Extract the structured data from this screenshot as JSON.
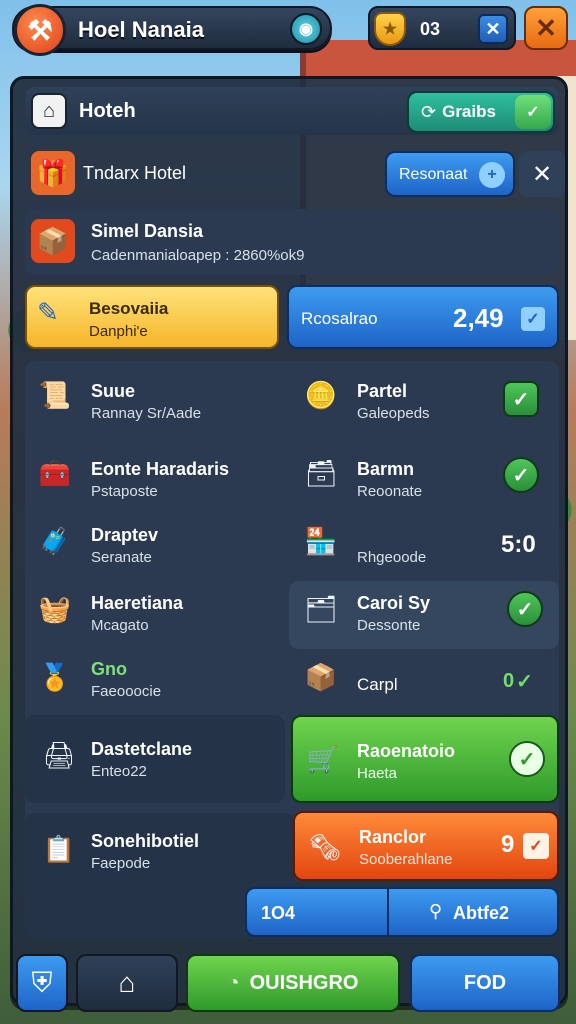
{
  "header": {
    "app_title": "Hoel Nanaia",
    "logo_icon": "hammer-icon",
    "coin_count": "03",
    "close_icon": "x-icon"
  },
  "panel": {
    "title": "Hoteh",
    "grab_button_label": "Graibs",
    "featured": {
      "title": "Tndarx Hotel",
      "reserve_label": "Resonaat"
    },
    "banner": {
      "title": "Simel Dansia",
      "subtitle": "Cadenmanialoapep : 2860%ok9"
    },
    "reservation_card": {
      "title": "Besovaiia",
      "subtitle": "Danphi'e"
    },
    "reservation_button": {
      "label": "Rcosalrao",
      "value": "2,49"
    },
    "items": [
      {
        "title": "Suue",
        "subtitle": "Rannay Sr/Aade",
        "icon": "scroll-icon"
      },
      {
        "title": "Partel",
        "subtitle": "Galeopeds",
        "icon": "coins-icon"
      },
      {
        "title": "Eonte Haradaris",
        "subtitle": "Pstaposte",
        "icon": "crate-icon"
      },
      {
        "title": "Barmn",
        "subtitle": "Reoonate",
        "icon": "chest-icon"
      },
      {
        "title": "Draptev",
        "subtitle": "Seranate",
        "icon": "toolbox-icon"
      },
      {
        "title": "Rhgeoode",
        "value": "5:0",
        "icon": "shop-icon"
      },
      {
        "title": "Haeretiana",
        "subtitle": "Mcagato",
        "icon": "basket-icon"
      },
      {
        "title": "Caroi Sy",
        "subtitle": "Dessonte",
        "icon": "paper-stack-icon"
      },
      {
        "title": "Gno",
        "subtitle": "Faeooocie",
        "icon": "medal-icon"
      },
      {
        "title": "Carpl",
        "value": "0",
        "icon": "box-icon"
      },
      {
        "title": "Dastetclane",
        "subtitle": "Enteo22",
        "icon": "printer-icon"
      },
      {
        "title": "Raoenatoio",
        "subtitle": "Haeta",
        "icon": "cart-icon"
      },
      {
        "title": "Sonehibotiel",
        "subtitle": "Faepode",
        "icon": "clipboard-icon"
      },
      {
        "title": "Ranclor",
        "subtitle": "Sooberahlane",
        "value": "9",
        "icon": "papers-icon"
      }
    ],
    "footer_pill": {
      "left": "1O4",
      "right": "Abtfe2"
    }
  },
  "bottom_nav": {
    "left_icon": "shield-icon",
    "home_icon": "home-icon",
    "primary_label": "OUISHGRO",
    "secondary_label": "FOD"
  },
  "colors": {
    "panel_bg": "#222e40",
    "accent_green": "#2e9a2a",
    "accent_blue": "#1e64c8",
    "accent_orange": "#e2450f",
    "accent_yellow": "#f5b52a"
  }
}
